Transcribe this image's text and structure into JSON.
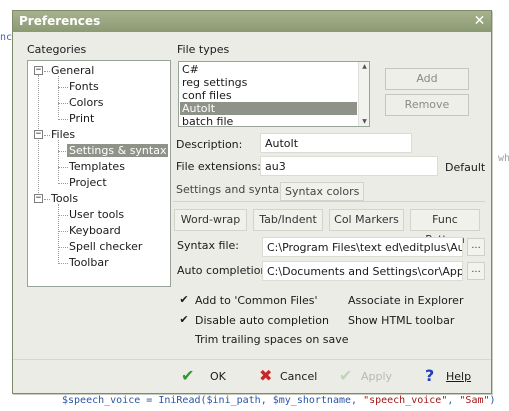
{
  "background": {
    "left_fragment": "nc",
    "right_fragment": "wh",
    "code_line": {
      "var": "$speech_voice",
      "op": " = ",
      "fn": "IniRead",
      "args": "($ini_path, $my_shortname, ",
      "str1": "\"speech_voice\"",
      "comma": ", ",
      "str2": "\"Sam\"",
      "close": ")"
    }
  },
  "window": {
    "title": "Preferences",
    "close": "✕"
  },
  "categories": {
    "label": "Categories",
    "tree": [
      {
        "label": "General",
        "expander": "−",
        "children": [
          "Fonts",
          "Colors",
          "Print"
        ]
      },
      {
        "label": "Files",
        "expander": "−",
        "children": [
          "Settings & syntax",
          "Templates",
          "Project"
        ],
        "selected": "Settings & syntax"
      },
      {
        "label": "Tools",
        "expander": "−",
        "children": [
          "User tools",
          "Keyboard",
          "Spell checker",
          "Toolbar"
        ]
      }
    ]
  },
  "file_types": {
    "label": "File types",
    "items": [
      "C#",
      "reg settings",
      "conf files",
      "AutoIt",
      "batch file"
    ],
    "selected": "AutoIt",
    "add_label": "Add",
    "remove_label": "Remove"
  },
  "description": {
    "label": "Description:",
    "value": "AutoIt"
  },
  "extensions": {
    "label": "File extensions:",
    "value": "au3",
    "default_label": "Default"
  },
  "tabs": {
    "settings": "Settings and syntax",
    "colors": "Syntax colors"
  },
  "subtabs": [
    "Word-wrap",
    "Tab/Indent",
    "Col Markers",
    "Func Pattern"
  ],
  "syntax_file": {
    "label": "Syntax file:",
    "value": "C:\\Program Files\\text ed\\editplus\\AutoIt",
    "browse": "..."
  },
  "auto_completion": {
    "label": "Auto completion:",
    "value": "C:\\Documents and Settings\\cor\\Applicat",
    "browse": "..."
  },
  "checkboxes": {
    "common_files": {
      "label": "Add to 'Common Files'",
      "checked": true,
      "mark": "✔"
    },
    "disable_auto": {
      "label": "Disable auto completion",
      "checked": true,
      "mark": "✔"
    },
    "trim": {
      "label": "Trim trailing spaces on save",
      "checked": false,
      "mark": ""
    },
    "assoc": {
      "label": "Associate in Explorer",
      "checked": false,
      "mark": ""
    },
    "html_toolbar": {
      "label": "Show HTML toolbar",
      "checked": false,
      "mark": ""
    }
  },
  "footer": {
    "ok": {
      "label": "OK",
      "icon": "✔"
    },
    "cancel": {
      "label": "Cancel",
      "icon": "✖"
    },
    "apply": {
      "label": "Apply",
      "icon": "✔"
    },
    "help": {
      "label": "Help",
      "icon": "?"
    }
  },
  "colors": {
    "check_green": "#2f9a2f",
    "cancel_red": "#c62828",
    "help_blue": "#1f3fbf"
  }
}
